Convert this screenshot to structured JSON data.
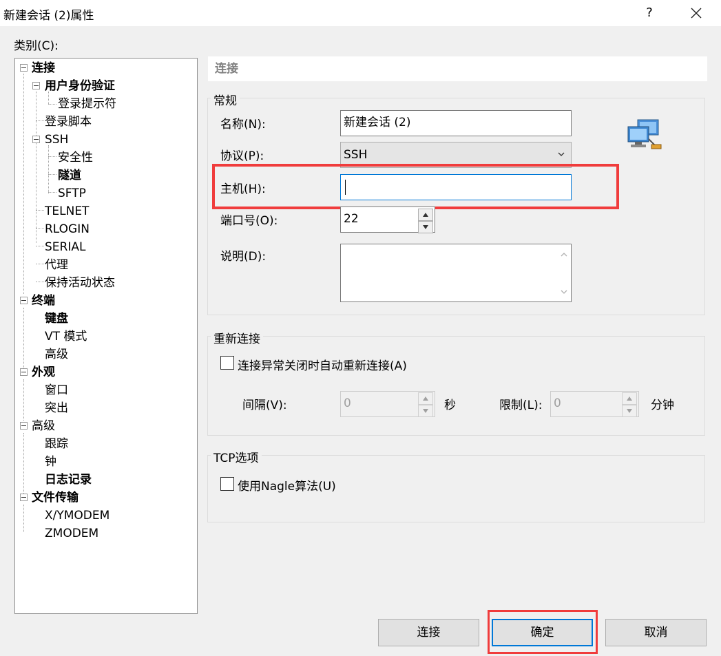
{
  "window": {
    "title": "新建会话 (2)属性",
    "help": "?"
  },
  "category_label": "类别(C):",
  "tree": [
    {
      "label": "连接",
      "bold": true
    },
    {
      "label": "用户身份验证",
      "bold": true
    },
    {
      "label": "登录提示符",
      "bold": false
    },
    {
      "label": "登录脚本",
      "bold": false
    },
    {
      "label": "SSH",
      "bold": false
    },
    {
      "label": "安全性",
      "bold": false
    },
    {
      "label": "隧道",
      "bold": true
    },
    {
      "label": "SFTP",
      "bold": false
    },
    {
      "label": "TELNET",
      "bold": false
    },
    {
      "label": "RLOGIN",
      "bold": false
    },
    {
      "label": "SERIAL",
      "bold": false
    },
    {
      "label": "代理",
      "bold": false
    },
    {
      "label": "保持活动状态",
      "bold": false
    },
    {
      "label": "终端",
      "bold": true
    },
    {
      "label": "键盘",
      "bold": true
    },
    {
      "label": "VT 模式",
      "bold": false
    },
    {
      "label": "高级",
      "bold": false
    },
    {
      "label": "外观",
      "bold": true
    },
    {
      "label": "窗口",
      "bold": false
    },
    {
      "label": "突出",
      "bold": false
    },
    {
      "label": "高级",
      "bold": false
    },
    {
      "label": "跟踪",
      "bold": false
    },
    {
      "label": "钟",
      "bold": false
    },
    {
      "label": "日志记录",
      "bold": true
    },
    {
      "label": "文件传输",
      "bold": true
    },
    {
      "label": "X/YMODEM",
      "bold": false
    },
    {
      "label": "ZMODEM",
      "bold": false
    }
  ],
  "section_title": "连接",
  "general": {
    "title": "常规",
    "name_label": "名称(N):",
    "name_value": "新建会话 (2)",
    "protocol_label": "协议(P):",
    "protocol_value": "SSH",
    "host_label": "主机(H):",
    "host_value": "",
    "port_label": "端口号(O):",
    "port_value": "22",
    "desc_label": "说明(D):",
    "desc_value": ""
  },
  "reconnect": {
    "title": "重新连接",
    "checkbox_label": "连接异常关闭时自动重新连接(A)",
    "interval_label": "间隔(V):",
    "interval_value": "0",
    "interval_unit": "秒",
    "limit_label": "限制(L):",
    "limit_value": "0",
    "limit_unit": "分钟"
  },
  "tcp": {
    "title": "TCP选项",
    "nagle_label": "使用Nagle算法(U)"
  },
  "buttons": {
    "connect": "连接",
    "ok": "确定",
    "cancel": "取消"
  },
  "colors": {
    "highlight_box": "#f03c3c",
    "focus_border": "#0078d7"
  }
}
